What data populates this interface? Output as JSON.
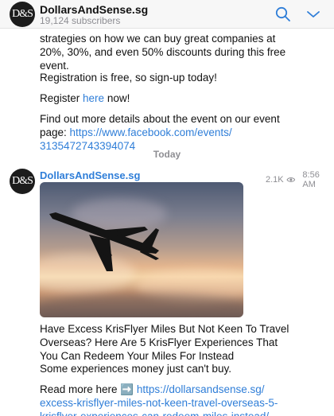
{
  "header": {
    "avatar_text": "D&S",
    "channel_name": "DollarsAndSense.sg",
    "subscribers": "19,124 subscribers"
  },
  "previous_message": {
    "line1": "strategies on how we can buy great companies at",
    "line2": "20%, 30%, and even 50% discounts during this free",
    "line3": "event.",
    "registration": "Registration is free, so sign-up today!",
    "register_prefix": "Register ",
    "register_link": "here",
    "register_suffix": " now!",
    "details_line1": "Find out more details about the event on our event",
    "details_prefix": "page: ",
    "details_link_line1": "https://www.facebook.com/events/",
    "details_link_line2": "3135472743394074"
  },
  "date_separator": "Today",
  "post": {
    "avatar_text": "D&S",
    "author": "DollarsAndSense.sg",
    "views": "2.1K",
    "time": "8:56 AM",
    "headline_line1": "Have Excess KrisFlyer Miles But Not Keen To Travel",
    "headline_line2": "Overseas? Here Are 5 KrisFlyer Experiences That",
    "headline_line3": "You Can Redeem Your Miles For Instead",
    "tagline": "Some experiences money just can't buy.",
    "read_more_prefix": "Read more here ",
    "read_more_emoji": "➡️",
    "link_line1": "https://dollarsandsense.sg/",
    "link_line2": "excess-krisflyer-miles-not-keen-travel-overseas-5-",
    "link_line3": "krisflyer-experiences-can-redeem-miles-instead/"
  },
  "colors": {
    "link": "#2f7ed8",
    "accent": "#2f7ed8",
    "muted": "#8e8e93"
  }
}
